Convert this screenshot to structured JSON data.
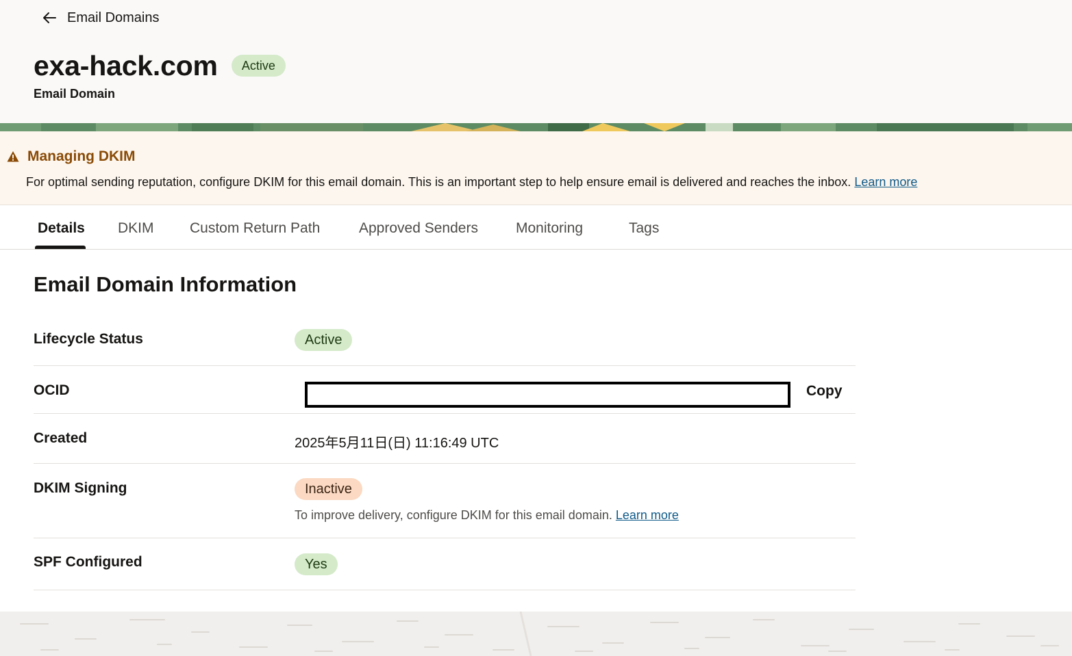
{
  "header": {
    "back_label": "Email Domains",
    "title": "exa-hack.com",
    "status_badge": "Active",
    "subtitle": "Email Domain"
  },
  "warning": {
    "title": "Managing DKIM",
    "message": "For optimal sending reputation, configure DKIM for this email domain. This is an important step to help ensure email is delivered and reaches the inbox.",
    "link_label": "Learn more",
    "icon": "warning-triangle-icon",
    "color": "#8a4b06"
  },
  "tabs": [
    {
      "label": "Details",
      "selected": true
    },
    {
      "label": "DKIM",
      "selected": false
    },
    {
      "label": "Custom Return Path",
      "selected": false
    },
    {
      "label": "Approved Senders",
      "selected": false
    },
    {
      "label": "Monitoring",
      "selected": false
    },
    {
      "label": "Tags",
      "selected": false
    }
  ],
  "section": {
    "title": "Email Domain Information",
    "rows": {
      "lifecycle": {
        "label": "Lifecycle Status",
        "value": "Active"
      },
      "ocid": {
        "label": "OCID",
        "value": "",
        "copy_label": "Copy"
      },
      "created": {
        "label": "Created",
        "value": "2025年5月11日(日) 11:16:49 UTC"
      },
      "dkim": {
        "label": "DKIM Signing",
        "value": "Inactive",
        "helper": "To improve delivery, configure DKIM for this email domain.",
        "link_label": "Learn more"
      },
      "spf": {
        "label": "SPF Configured",
        "value": "Yes"
      }
    }
  },
  "colors": {
    "active_badge": "#d4eac9",
    "inactive_badge": "#fbd9c2",
    "link": "#0f5a89"
  }
}
